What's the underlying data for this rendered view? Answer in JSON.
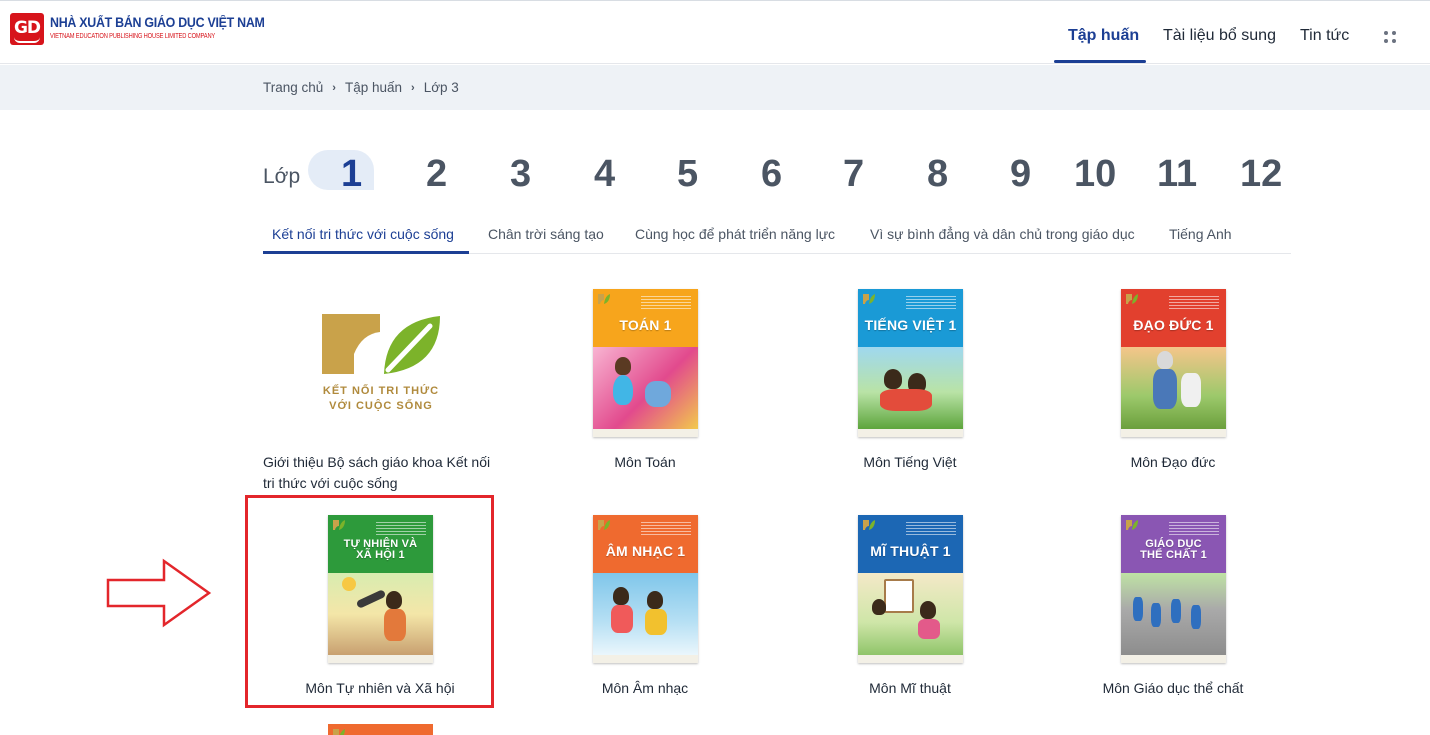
{
  "header": {
    "logo_title": "NHÀ XUẤT BẢN GIÁO DỤC VIỆT NAM",
    "logo_subtitle": "VIETNAM EDUCATION PUBLISHING HOUSE LIMITED COMPANY",
    "logo_mark": "GD",
    "nav": [
      {
        "label": "Tập huấn",
        "active": true
      },
      {
        "label": "Tài liệu bổ sung",
        "active": false
      },
      {
        "label": "Tin tức",
        "active": false
      }
    ],
    "apps_icon": "grid-dots-icon"
  },
  "breadcrumb": {
    "items": [
      "Trang chủ",
      "Tập huấn",
      "Lớp 3"
    ],
    "separator": "›"
  },
  "grades": {
    "label": "Lớp",
    "items": [
      "1",
      "2",
      "3",
      "4",
      "5",
      "6",
      "7",
      "8",
      "9",
      "10",
      "11",
      "12"
    ],
    "selected": "1"
  },
  "series_tabs": {
    "items": [
      "Kết nối tri thức với cuộc sống",
      "Chân trời sáng tạo",
      "Cùng học để phát triển năng lực",
      "Vì sự bình đẳng và dân chủ trong giáo dục",
      "Tiếng Anh"
    ],
    "selected": 0
  },
  "intro_card": {
    "logo_line1": "KẾT NỐI TRI THỨC",
    "logo_line2": "VỚI CUỘC SỐNG",
    "title": "Giới thiệu Bộ sách giáo khoa Kết nối tri thức với cuộc sống"
  },
  "books": [
    {
      "title": "Môn Toán",
      "cover_title": "TOÁN 1",
      "color": "#f7a51c"
    },
    {
      "title": "Môn Tiếng Việt",
      "cover_title": "TIẾNG VIỆT 1",
      "color": "#1a9ad6"
    },
    {
      "title": "Môn Đạo đức",
      "cover_title": "ĐẠO ĐỨC 1",
      "color": "#e2402e"
    },
    {
      "title": "Môn Tự nhiên và Xã hội",
      "cover_title": "TỰ NHIÊN VÀ XÃ HỘI 1",
      "color": "#2d9a3b"
    },
    {
      "title": "Môn Âm nhạc",
      "cover_title": "ÂM NHẠC 1",
      "color": "#ef6a2f"
    },
    {
      "title": "Môn Mĩ thuật",
      "cover_title": "MĨ THUẬT 1",
      "color": "#1c67b4"
    },
    {
      "title": "Môn Giáo dục thể chất",
      "cover_title": "GIÁO DỤC THỂ CHẤT 1",
      "color": "#8a56b3"
    }
  ],
  "colors": {
    "brand_blue": "#1c3f94",
    "brand_red": "#d7141b",
    "highlight_red": "#e3262b"
  }
}
